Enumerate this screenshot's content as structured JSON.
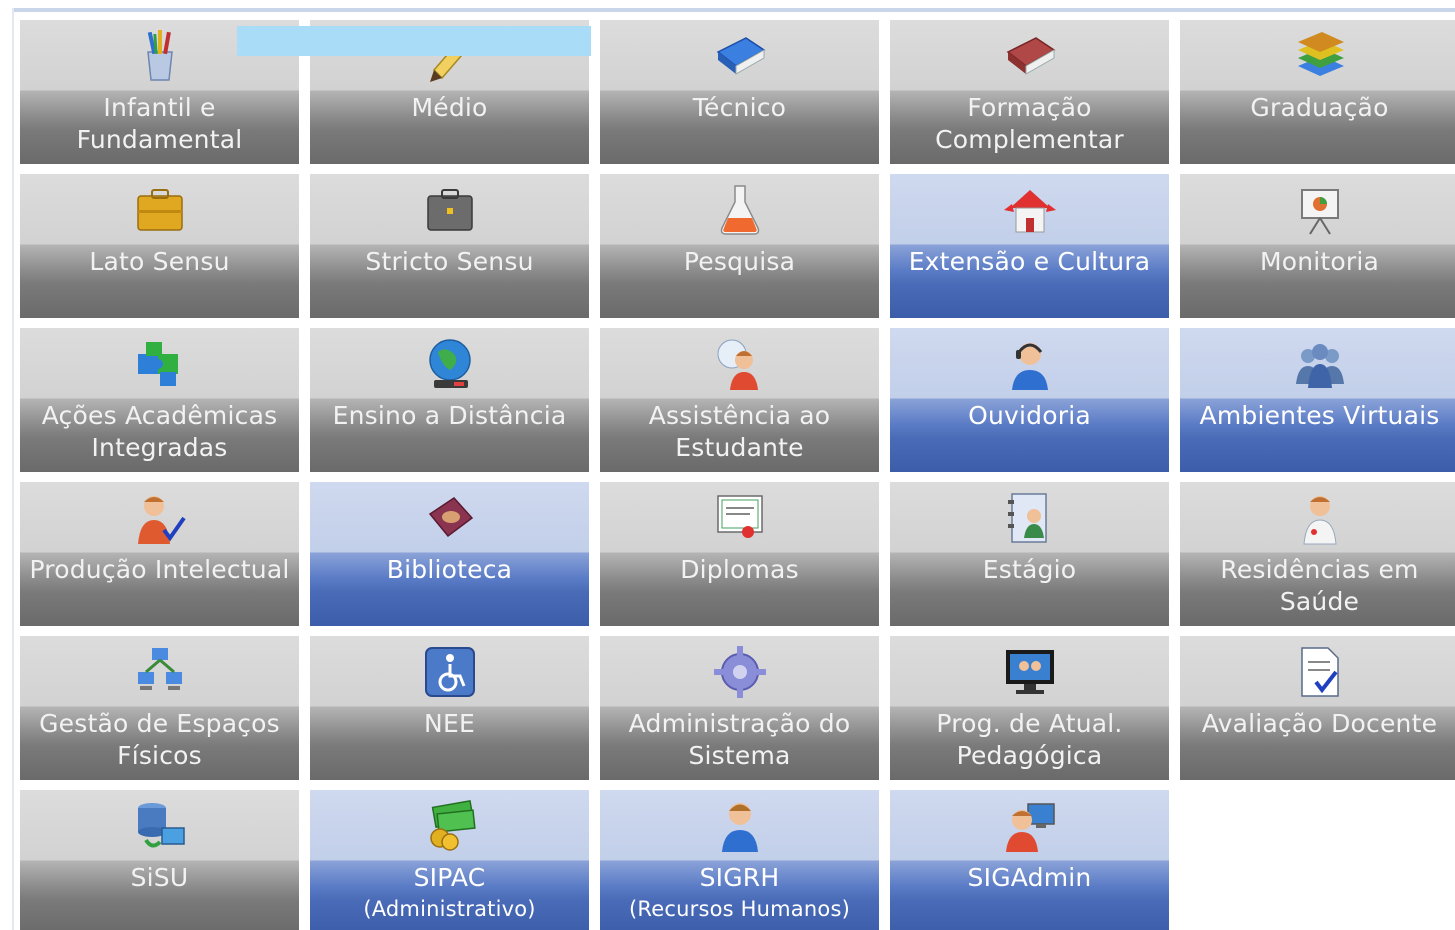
{
  "colors": {
    "tile_gray_top": "#d2d2d2",
    "tile_gray_bottom": "#6a6a6a",
    "tile_blue_top": "#c2cfe9",
    "tile_blue_bottom": "#3c5eaa",
    "label_text": "#ffffff",
    "overlay_bar": "#a9dcf6"
  },
  "tiles": [
    {
      "label": "Infantil e\nFundamental",
      "sub": "",
      "icon": "pencil-cup-icon",
      "active": false
    },
    {
      "label": "Médio",
      "sub": "",
      "icon": "pencil-icon",
      "active": false
    },
    {
      "label": "Técnico",
      "sub": "",
      "icon": "blue-book-icon",
      "active": false
    },
    {
      "label": "Formação\nComplementar",
      "sub": "",
      "icon": "red-book-icon",
      "active": false
    },
    {
      "label": "Graduação",
      "sub": "",
      "icon": "book-stack-icon",
      "active": false
    },
    {
      "label": "Lato Sensu",
      "sub": "",
      "icon": "yellow-briefcase-icon",
      "active": false
    },
    {
      "label": "Stricto Sensu",
      "sub": "",
      "icon": "gray-briefcase-icon",
      "active": false
    },
    {
      "label": "Pesquisa",
      "sub": "",
      "icon": "flask-icon",
      "active": false
    },
    {
      "label": "Extensão e Cultura",
      "sub": "",
      "icon": "house-icon",
      "active": true
    },
    {
      "label": "Monitoria",
      "sub": "",
      "icon": "presentation-board-icon",
      "active": false
    },
    {
      "label": "Ações Acadêmicas\nIntegradas",
      "sub": "",
      "icon": "puzzle-icon",
      "active": false
    },
    {
      "label": "Ensino a Distância",
      "sub": "",
      "icon": "globe-icon",
      "active": false
    },
    {
      "label": "Assistência ao\nEstudante",
      "sub": "",
      "icon": "support-person-icon",
      "active": false
    },
    {
      "label": "Ouvidoria",
      "sub": "",
      "icon": "headset-icon",
      "active": true
    },
    {
      "label": "Ambientes Virtuais",
      "sub": "",
      "icon": "group-icon",
      "active": true
    },
    {
      "label": "Produção Intelectual",
      "sub": "",
      "icon": "user-check-icon",
      "active": false
    },
    {
      "label": "Biblioteca",
      "sub": "",
      "icon": "library-book-icon",
      "active": true
    },
    {
      "label": "Diplomas",
      "sub": "",
      "icon": "certificate-icon",
      "active": false
    },
    {
      "label": "Estágio",
      "sub": "",
      "icon": "contact-book-icon",
      "active": false
    },
    {
      "label": "Residências em\nSaúde",
      "sub": "",
      "icon": "doctor-icon",
      "active": false
    },
    {
      "label": "Gestão de Espaços\nFísicos",
      "sub": "",
      "icon": "network-icon",
      "active": false
    },
    {
      "label": "NEE",
      "sub": "",
      "icon": "accessibility-icon",
      "active": false
    },
    {
      "label": "Administração do\nSistema",
      "sub": "",
      "icon": "gear-icon",
      "active": false
    },
    {
      "label": "Prog. de Atual.\nPedagógica",
      "sub": "",
      "icon": "monitor-icon",
      "active": false
    },
    {
      "label": "Avaliação Docente",
      "sub": "",
      "icon": "document-check-icon",
      "active": false
    },
    {
      "label": "SiSU",
      "sub": "",
      "icon": "database-icon",
      "active": false
    },
    {
      "label": "SIPAC",
      "sub": "(Administrativo)",
      "icon": "money-icon",
      "active": true
    },
    {
      "label": "SIGRH",
      "sub": "(Recursos Humanos)",
      "icon": "person-icon",
      "active": true
    },
    {
      "label": "SIGAdmin",
      "sub": "",
      "icon": "admin-user-icon",
      "active": true
    }
  ]
}
